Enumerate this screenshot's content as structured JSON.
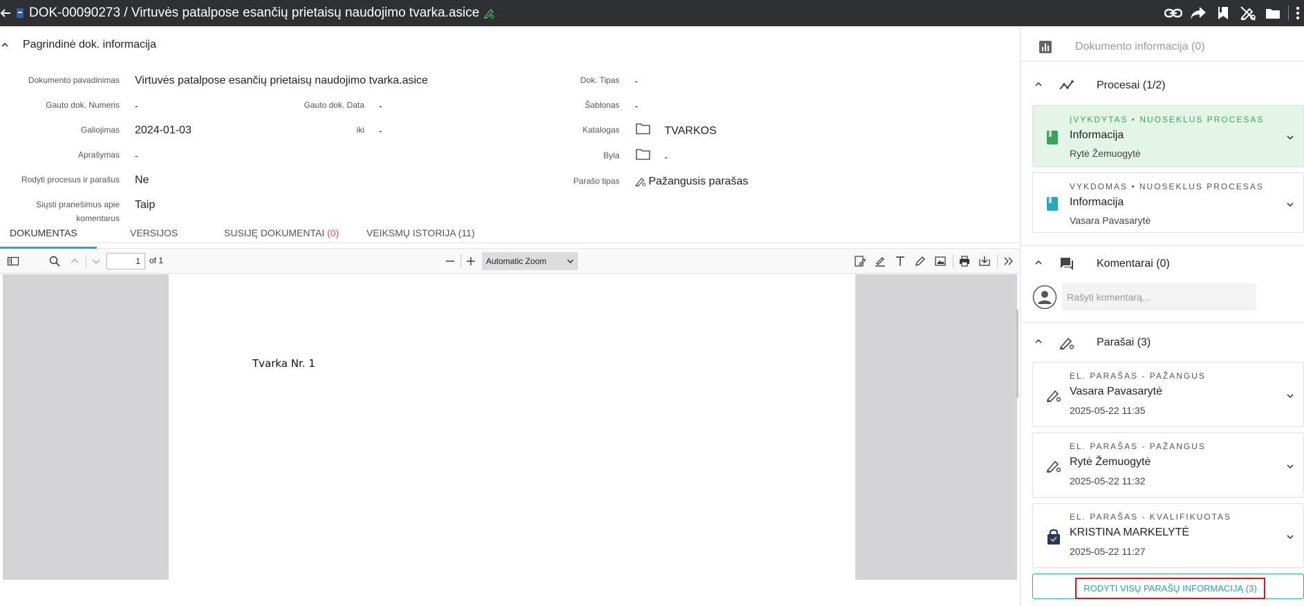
{
  "header": {
    "title": "DOK-00090273 / Virtuvės patalpose esančių prietaisų naudojimo tvarka.asice",
    "icons": [
      "arrow-back-icon",
      "file-icon",
      "signature-icon",
      "link-icon",
      "share-icon",
      "bookmark-icon",
      "sign-off-icon",
      "folder-icon",
      "more-vert-icon"
    ],
    "accent_green": "#4caf50"
  },
  "info": {
    "section_title": "Pagrindinė dok. informacija",
    "fields": {
      "doc_name_label": "Dokumento pavadinimas",
      "doc_name_value": "Virtuvės patalpose esančių prietaisų naudojimo tvarka.asice",
      "recv_number_label": "Gauto dok. Numeris",
      "recv_number_value": "-",
      "recv_date_label": "Gauto dok. Data",
      "recv_date_value": "-",
      "validity_label": "Galiojimas",
      "validity_value": "2024-01-03",
      "until_label": "iki",
      "until_value": "-",
      "description_label": "Aprašymas",
      "description_value": "-",
      "show_processes_label": "Rodyti procesus ir parašus",
      "show_processes_value": "Ne",
      "notify_label_line1": "Siųsti pranešimus apie",
      "notify_label_line2": "komentarus",
      "notify_value": "Taip",
      "doc_type_label": "Dok. Tipas",
      "doc_type_value": "-",
      "template_label": "Šablonas",
      "template_value": "-",
      "catalog_label": "Katalogas",
      "catalog_value": "TVARKOS",
      "case_label": "Byla",
      "case_value": "-",
      "sig_type_label": "Parašo tipas",
      "sig_type_value": "Pažangusis parašas"
    }
  },
  "tabs": [
    {
      "label": "DOKUMENTAS"
    },
    {
      "label": "VERSIJOS"
    },
    {
      "label": "SUSIJĘ DOKUMENTAI",
      "count": "(0)"
    },
    {
      "label": "VEIKSMŲ ISTORIJA (11)"
    }
  ],
  "pdf": {
    "page_value": "1",
    "page_of": "of 1",
    "zoom": "Automatic Zoom",
    "page_text": "Tvarka Nr. 1"
  },
  "right": {
    "doc_info_header": "Dokumento informacija (0)",
    "processes_header": "Procesai (1/2)",
    "processes": [
      {
        "status": "ĮVYKDYTAS • NUOSEKLUS PROCESAS",
        "title": "Informacija",
        "person": "Rytė Žemuogytė",
        "color": "#3aa35a"
      },
      {
        "status": "VYKDOMAS • NUOSEKLUS PROCESAS",
        "title": "Informacija",
        "person": "Vasara Pavasarytė",
        "color": "#26a9bd"
      }
    ],
    "comments_header": "Komentarai (0)",
    "comment_placeholder": "Rašyti komentarą...",
    "signatures_header": "Parašai (3)",
    "signatures": [
      {
        "type": "EL. PARAŠAS - PAŽANGUS",
        "name": "Vasara Pavasarytė",
        "time": "2025-05-22 11:35",
        "icon": "signature-icon"
      },
      {
        "type": "EL. PARAŠAS - PAŽANGUS",
        "name": "Rytė Žemuogytė",
        "time": "2025-05-22 11:32",
        "icon": "signature-icon"
      },
      {
        "type": "EL. PARAŠAS - KVALIFIKUOTAS",
        "name": "KRISTINA MARKELYTĖ",
        "time": "2025-05-22 11:27",
        "icon": "qualified-lock-icon"
      }
    ],
    "show_all_label": "RODYTI VISŲ PARAŠŲ INFORMACIJĄ (3)",
    "highlight_color": "#e3111c"
  }
}
